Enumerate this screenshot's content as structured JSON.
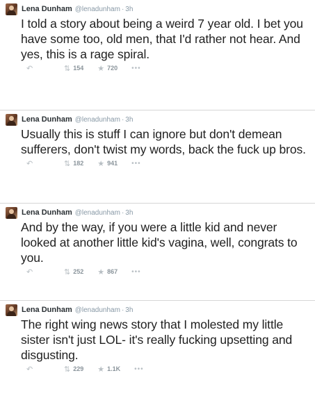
{
  "tweets": [
    {
      "name": "Lena Dunham",
      "handle": "@lenadunham",
      "time": "3h",
      "text": "I told a story about being a weird 7 year old. I bet you have some too, old men, that I'd rather not hear. And yes, this is a rage spiral.",
      "retweets": "154",
      "favorites": "720"
    },
    {
      "name": "Lena Dunham",
      "handle": "@lenadunham",
      "time": "3h",
      "text": "Usually this is stuff I can ignore but don't demean sufferers, don't twist my words, back the fuck up bros.",
      "retweets": "182",
      "favorites": "941"
    },
    {
      "name": "Lena Dunham",
      "handle": "@lenadunham",
      "time": "3h",
      "text": "And by the way, if you were a little kid and never looked at another little kid's vagina, well, congrats to you.",
      "retweets": "252",
      "favorites": "867"
    },
    {
      "name": "Lena Dunham",
      "handle": "@lenadunham",
      "time": "3h",
      "text": "The right wing news story that I molested my little sister isn't just LOL- it's really fucking upsetting and disgusting.",
      "retweets": "229",
      "favorites": "1.1K"
    }
  ],
  "icons": {
    "reply": "reply-icon",
    "retweet": "retweet-icon",
    "favorite": "star-icon",
    "more": "more-icon"
  },
  "separator": "·"
}
